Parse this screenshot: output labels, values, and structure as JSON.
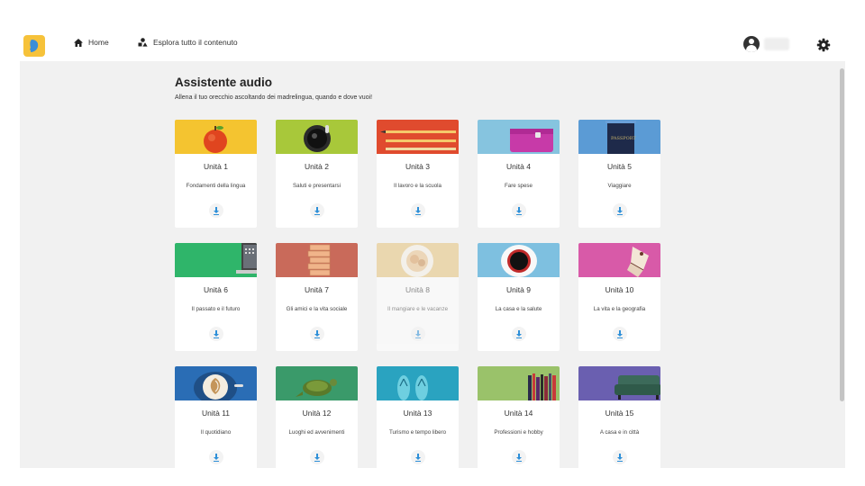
{
  "nav": {
    "home_label": "Home",
    "explore_label": "Esplora tutto il contenuto"
  },
  "colors": {
    "brand": "#f6c23a",
    "download": "#2d8fd8",
    "background": "#f1f1f1"
  },
  "page": {
    "title": "Assistente audio",
    "subtitle": "Allena il tuo orecchio ascoltando dei madrelingua, quando e dove vuoi!"
  },
  "units": [
    {
      "title": "Unità 1",
      "desc": "Fondamenti della lingua",
      "image": "apple",
      "color": "#f4c430"
    },
    {
      "title": "Unità 2",
      "desc": "Saluti e presentarsi",
      "image": "cup",
      "color": "#a8c83a"
    },
    {
      "title": "Unità 3",
      "desc": "Il lavoro e la scuola",
      "image": "pencils",
      "color": "#e04b2e"
    },
    {
      "title": "Unità 4",
      "desc": "Fare spese",
      "image": "wallet",
      "color": "#86c4df"
    },
    {
      "title": "Unità 5",
      "desc": "Viaggiare",
      "image": "passport",
      "color": "#5b9bd5"
    },
    {
      "title": "Unità 6",
      "desc": "Il passato e il futuro",
      "image": "laptop",
      "color": "#2fb56a"
    },
    {
      "title": "Unità 7",
      "desc": "Gli amici e la vita sociale",
      "image": "jenga",
      "color": "#c96a5a"
    },
    {
      "title": "Unità 8",
      "desc": "Il mangiare e le vacanze",
      "image": "plate",
      "color": "#e6c27a",
      "dim": true
    },
    {
      "title": "Unità 9",
      "desc": "La casa e la salute",
      "image": "coffee",
      "color": "#7ec0e0"
    },
    {
      "title": "Unità 10",
      "desc": "La vita e la geografia",
      "image": "butterfly",
      "color": "#d85aa8"
    },
    {
      "title": "Unità 11",
      "desc": "Il quotidiano",
      "image": "latte",
      "color": "#2a6db5"
    },
    {
      "title": "Unità 12",
      "desc": "Luoghi ed avvenimenti",
      "image": "turtle",
      "color": "#3a9a6a"
    },
    {
      "title": "Unità 13",
      "desc": "Turismo e tempo libero",
      "image": "flipflops",
      "color": "#2aa3c0"
    },
    {
      "title": "Unità 14",
      "desc": "Professioni e hobby",
      "image": "books",
      "color": "#9ac26a"
    },
    {
      "title": "Unità 15",
      "desc": "A casa e in città",
      "image": "sofa",
      "color": "#6a5fb0"
    }
  ]
}
